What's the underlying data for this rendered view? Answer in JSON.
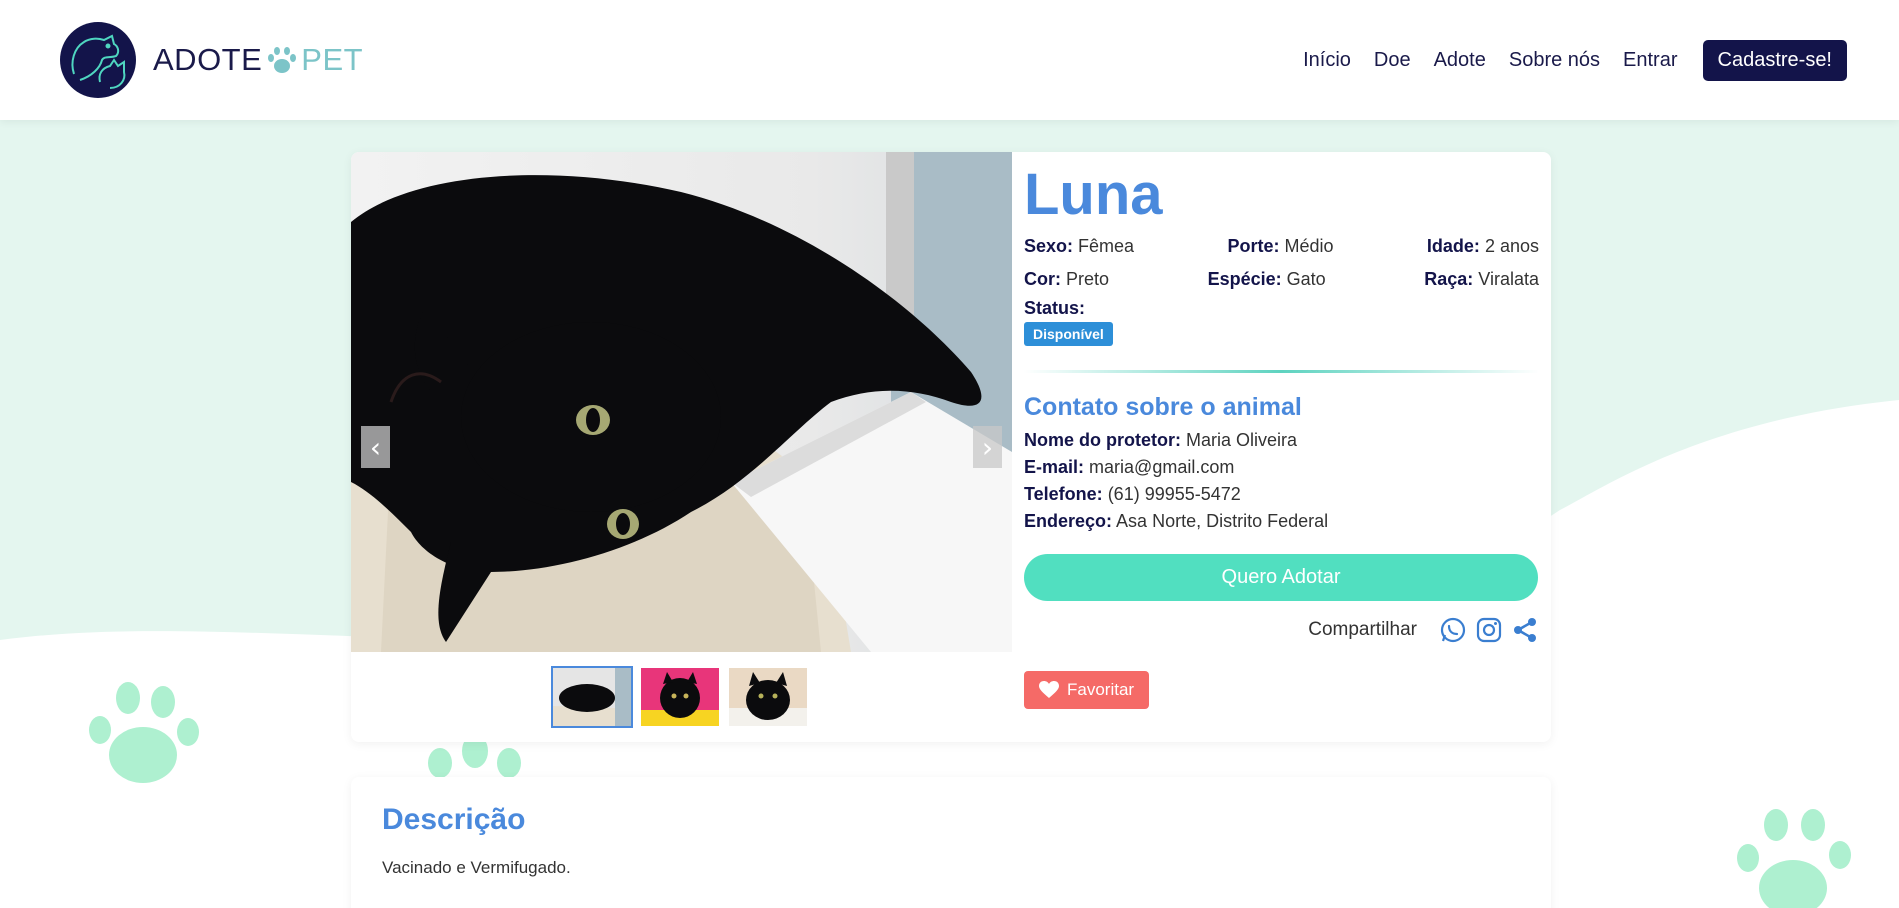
{
  "brand": {
    "part1": "ADOTE",
    "part2": "PET"
  },
  "nav": {
    "items": [
      "Início",
      "Doe",
      "Adote",
      "Sobre nós",
      "Entrar"
    ],
    "cta": "Cadastre-se!"
  },
  "carousel": {
    "prev": "‹",
    "next": "›",
    "thumb_count": 3,
    "active_index": 0
  },
  "pet": {
    "name": "Luna",
    "attributes": [
      {
        "label": "Sexo:",
        "value": "Fêmea"
      },
      {
        "label": "Porte:",
        "value": "Médio"
      },
      {
        "label": "Idade:",
        "value": "2 anos"
      },
      {
        "label": "Cor:",
        "value": "Preto"
      },
      {
        "label": "Espécie:",
        "value": "Gato"
      },
      {
        "label": "Raça:",
        "value": "Viralata"
      }
    ],
    "status_label": "Status:",
    "status_value": "Disponível"
  },
  "contact": {
    "title": "Contato sobre o animal",
    "lines": [
      {
        "label": "Nome do protetor:",
        "value": "Maria Oliveira"
      },
      {
        "label": "E-mail:",
        "value": "maria@gmail.com"
      },
      {
        "label": "Telefone:",
        "value": "(61) 99955-5472"
      },
      {
        "label": "Endereço:",
        "value": "Asa Norte, Distrito Federal"
      }
    ]
  },
  "actions": {
    "adopt": "Quero Adotar",
    "share_label": "Compartilhar",
    "share_icons": [
      "whatsapp-icon",
      "instagram-icon",
      "share-icon"
    ],
    "favorite": "Favoritar"
  },
  "description": {
    "title": "Descrição",
    "text": "Vacinado e Vermifugado."
  },
  "colors": {
    "navy": "#13144a",
    "blue": "#4a89dc",
    "mint": "#51dfc0",
    "mint_bg": "#e4f6ef",
    "paw": "#aef0d0",
    "favorite": "#f56a67",
    "badge": "#2d8fd8"
  }
}
